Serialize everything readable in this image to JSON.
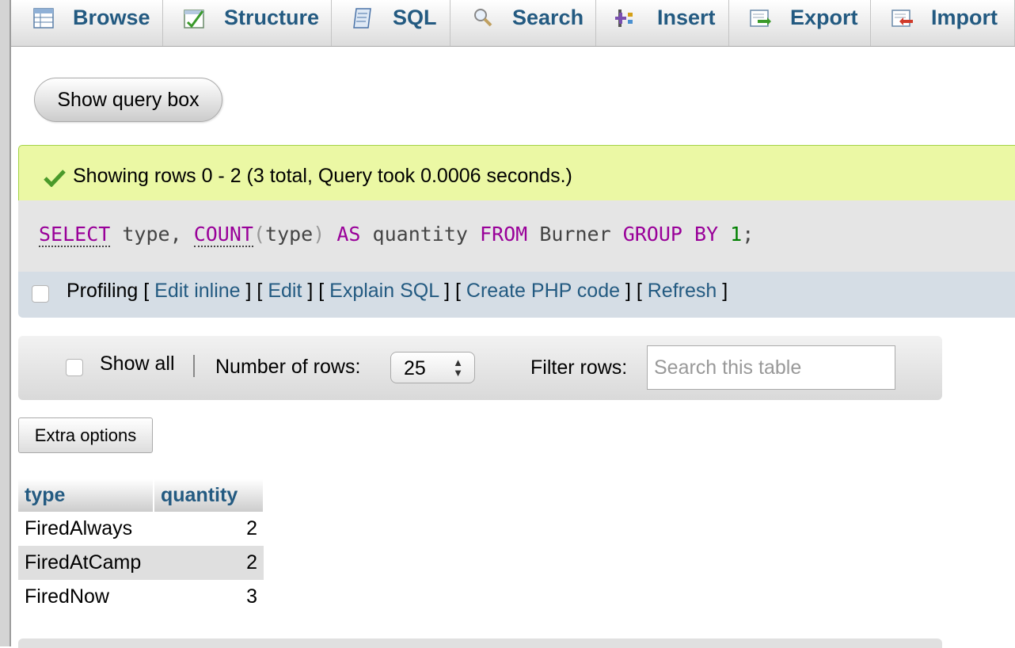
{
  "tabs": [
    {
      "label": "Browse",
      "icon": "browse-icon"
    },
    {
      "label": "Structure",
      "icon": "structure-icon"
    },
    {
      "label": "SQL",
      "icon": "sql-icon"
    },
    {
      "label": "Search",
      "icon": "search-icon"
    },
    {
      "label": "Insert",
      "icon": "insert-icon"
    },
    {
      "label": "Export",
      "icon": "export-icon"
    },
    {
      "label": "Import",
      "icon": "import-icon"
    }
  ],
  "query_box_button": "Show query box",
  "success_message": "Showing rows 0 - 2 (3 total, Query took 0.0006 seconds.)",
  "sql": {
    "select": "SELECT",
    "col1": "type,",
    "count": "COUNT",
    "arg": "type",
    "as": "AS",
    "alias": "quantity",
    "from": "FROM",
    "table": "Burner",
    "group_by": "GROUP BY",
    "num": "1",
    "end": ";"
  },
  "profiling": {
    "label": "Profiling",
    "links": [
      "Edit inline",
      "Edit",
      "Explain SQL",
      "Create PHP code",
      "Refresh"
    ]
  },
  "nav": {
    "show_all": "Show all",
    "rows_label": "Number of rows:",
    "rows_value": "25",
    "filter_label": "Filter rows:",
    "filter_placeholder": "Search this table"
  },
  "extra_options": "Extra options",
  "table": {
    "columns": [
      "type",
      "quantity"
    ],
    "rows": [
      [
        "FiredAlways",
        "2"
      ],
      [
        "FiredAtCamp",
        "2"
      ],
      [
        "FiredNow",
        "3"
      ]
    ]
  },
  "colors": {
    "link": "#235a81",
    "success_bg": "#ebf8a4",
    "keyword": "#990099"
  }
}
